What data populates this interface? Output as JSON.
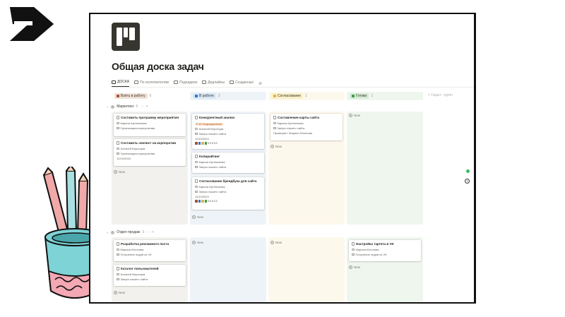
{
  "page": {
    "title": "Общая доска задач"
  },
  "views": [
    {
      "label": "ДОСКА",
      "icon": "board-icon",
      "active": true
    },
    {
      "label": "По исполнителям",
      "icon": "board-icon"
    },
    {
      "label": "Подзадачи",
      "icon": "table-icon"
    },
    {
      "label": "Дедлайны",
      "icon": "calendar-icon"
    },
    {
      "label": "Созданные",
      "icon": "table-icon"
    }
  ],
  "columns": [
    {
      "label": "Взять в работу",
      "count": "6",
      "color": "#a0522d",
      "pill_bg": "#f1e2d6"
    },
    {
      "label": "В работе",
      "count": "3",
      "color": "#2f76c8",
      "pill_bg": "#d8e7f6"
    },
    {
      "label": "Согласование",
      "count": "1",
      "color": "#e3b341",
      "pill_bg": "#faf0c8"
    },
    {
      "label": "Готово",
      "count": "1",
      "color": "#3f9b4a",
      "pill_bg": "#d6ecd6"
    }
  ],
  "add_group_label": "+ Скрыт.. групп",
  "groups": [
    {
      "label": "Маркетинг",
      "count": "6",
      "tools": "··· +"
    },
    {
      "label": "Отдел продаж",
      "count": "3",
      "tools": "··· +"
    }
  ],
  "new_label": "New",
  "cards": {
    "g1c1": [
      {
        "title": "Составить программу мероприятия",
        "person": "Карина Артемонова",
        "project": "Организация корпоратива"
      },
      {
        "title": "Составить чеклист на корпоратив",
        "person": "Алексей Воронцов",
        "project": "Организация корпоратива",
        "date": "12/10/2024"
      }
    ],
    "g1c2": [
      {
        "title": "Конкурентный анализ",
        "tag": "Р-Ю Подразделения",
        "person": "Алексей Воронцов",
        "project": "Запуск нашего сайта",
        "date": "11/10/2024",
        "progress": "0 0 0 0 0"
      },
      {
        "title": "Копирайтинг",
        "person": "Карина Артемонова",
        "project": "Запуск нашего сайта"
      },
      {
        "title": "Согласование брендбука для сайта",
        "person": "Карина Артемонова",
        "project": "Запуск нашего сайта",
        "date": "11/10/2024",
        "progress": "0 0 0 2 2"
      }
    ],
    "g1c3": [
      {
        "title": "Составление карты сайта",
        "person": "Карина Артемонова",
        "project": "Запуск нашего сайта",
        "extra": "Проверяет: Марина Юлонова"
      }
    ],
    "g2c1": [
      {
        "title": "Разработка рекламного поста",
        "person": "Марина Юлонова",
        "project": "Получение лидов из VK"
      },
      {
        "title": "Каталог пользователей",
        "person": "Алексей Воронцов",
        "project": "Запуск нашего сайта"
      }
    ],
    "g2c4": [
      {
        "title": "Настройка таргета в VK",
        "person": "Марина Юлонова",
        "project": "Получение лидов из VK"
      }
    ]
  },
  "colors": {
    "tag_bg": "#fbe3cf",
    "status_green": "#3cba5c",
    "progress": [
      "#a0522d",
      "#2f76c8",
      "#e3b341",
      "#3f9b4a",
      "#9b9a97"
    ]
  }
}
